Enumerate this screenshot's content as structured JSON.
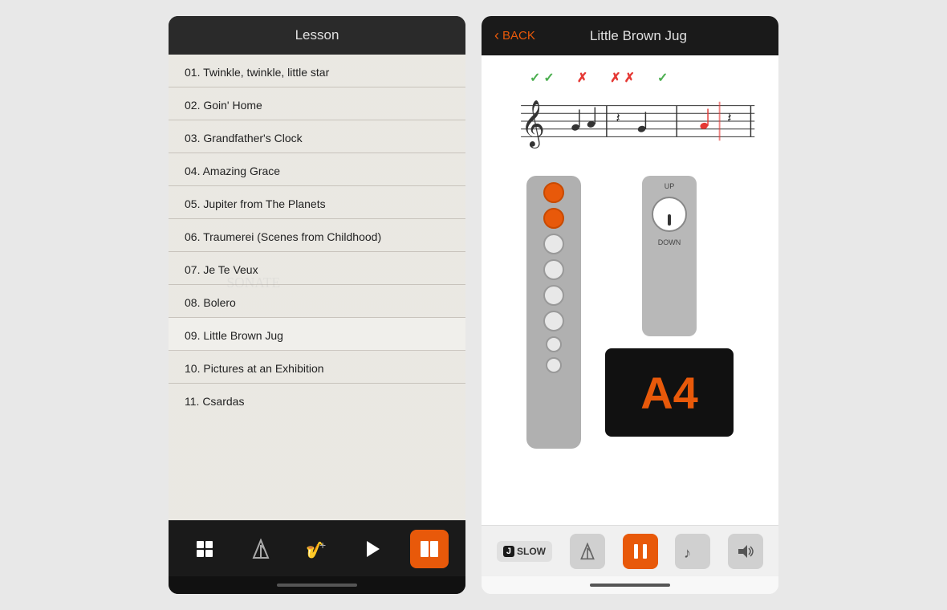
{
  "left_panel": {
    "header": "Lesson",
    "lessons": [
      {
        "num": "01",
        "title": "Twinkle, twinkle, little star"
      },
      {
        "num": "02",
        "title": "Goin' Home"
      },
      {
        "num": "03",
        "title": "Grandfather's Clock"
      },
      {
        "num": "04",
        "title": "Amazing Grace"
      },
      {
        "num": "05",
        "title": "Jupiter from The Planets"
      },
      {
        "num": "06",
        "title": "Traumerei (Scenes from Childhood)"
      },
      {
        "num": "07",
        "title": "Je Te Veux"
      },
      {
        "num": "08",
        "title": "Bolero"
      },
      {
        "num": "09",
        "title": "Little Brown Jug"
      },
      {
        "num": "10",
        "title": "Pictures at an Exhibition"
      },
      {
        "num": "11",
        "title": "Csardas"
      }
    ],
    "toolbar": {
      "grid_icon": "⊞",
      "metronome_icon": "♩",
      "plus_icon": "+𝄞",
      "play_icon": "▶",
      "book_icon": "📖"
    }
  },
  "right_panel": {
    "back_label": "BACK",
    "title": "Little Brown Jug",
    "checks": [
      "✓",
      "✓",
      "✗",
      "✗",
      "✗",
      "✓"
    ],
    "note": "A4",
    "playback": {
      "slow_label": "SLOW",
      "slow_j": "J"
    }
  }
}
